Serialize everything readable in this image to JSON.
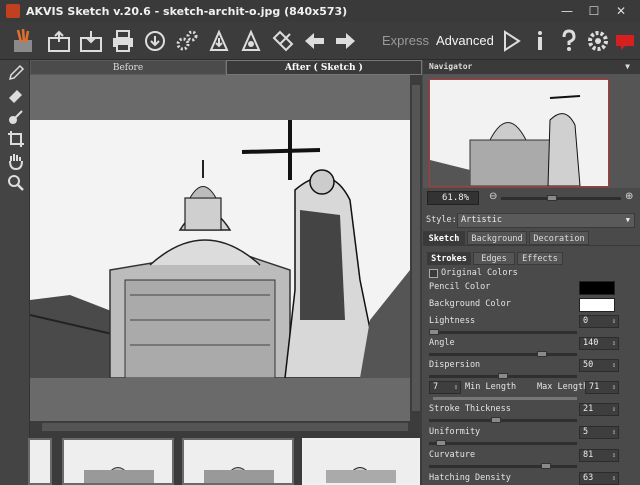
{
  "window": {
    "title": "AKVIS Sketch v.20.6 - sketch-archit-o.jpg (840x573)"
  },
  "toolbar": {
    "express_label": "Express",
    "advanced_label": "Advanced"
  },
  "canvas_tabs": {
    "before": "Before",
    "after": "After ( Sketch )"
  },
  "navigator": {
    "title": "Navigator",
    "zoom": "61.8%"
  },
  "style": {
    "label": "Style:",
    "value": "Artistic"
  },
  "panel_tabs": [
    "Sketch",
    "Background",
    "Decoration"
  ],
  "sub_tabs": [
    "Strokes",
    "Edges",
    "Effects"
  ],
  "params": {
    "original_colors": "Original Colors",
    "pencil_color": "Pencil Color",
    "background_color": "Background Color",
    "lightness": {
      "label": "Lightness",
      "value": "0",
      "level": 0.0
    },
    "angle": {
      "label": "Angle",
      "value": "140",
      "level": 0.78
    },
    "dispersion": {
      "label": "Dispersion",
      "value": "50",
      "level": 0.5
    },
    "min_length": {
      "label": "Min Length",
      "value": "7"
    },
    "max_length": {
      "label": "Max Length",
      "value": "71"
    },
    "stroke_thickness": {
      "label": "Stroke Thickness",
      "value": "21",
      "level": 0.45
    },
    "uniformity": {
      "label": "Uniformity",
      "value": "5",
      "level": 0.05
    },
    "curvature": {
      "label": "Curvature",
      "value": "81",
      "level": 0.81
    },
    "hatching_density": {
      "label": "Hatching Density",
      "value": "63",
      "level": 0.63
    }
  },
  "colors": {
    "pencil": "#000000",
    "background": "#ffffff"
  }
}
